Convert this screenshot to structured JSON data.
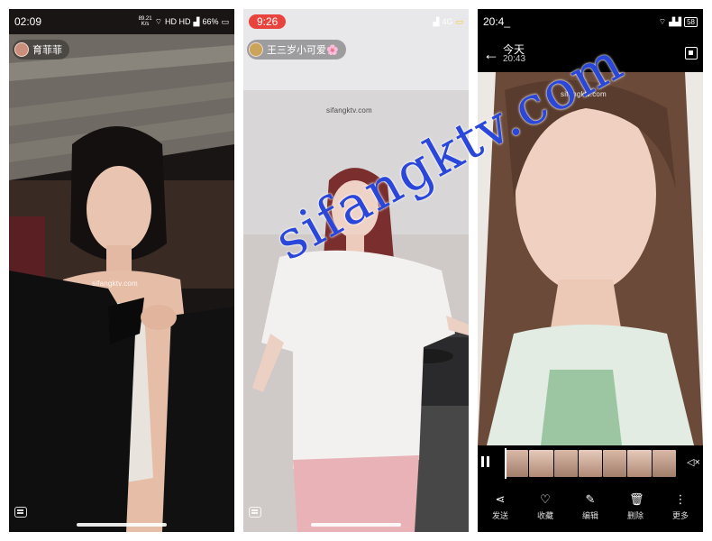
{
  "watermark": "sifangktv.com",
  "small_watermark": "sifangktv.com",
  "panel1": {
    "time": "02:09",
    "net_speed_top": "89.21",
    "net_speed_unit": "K/s",
    "signal_text": "HD HD",
    "battery": "66%",
    "streamer_name": "育菲菲"
  },
  "panel2": {
    "time": "9:26",
    "network": "4G",
    "streamer_name": "王三岁小可爱🌸"
  },
  "panel3": {
    "status_time": "20:4_",
    "viewer_title": "今天",
    "viewer_subtitle": "20:43",
    "battery": "58",
    "toolbar": [
      {
        "label": "发送",
        "icon": "share-icon",
        "glyph": "⋖"
      },
      {
        "label": "收藏",
        "icon": "heart-icon",
        "glyph": "♡"
      },
      {
        "label": "编辑",
        "icon": "edit-icon",
        "glyph": "✎"
      },
      {
        "label": "删除",
        "icon": "trash-icon",
        "glyph": "🗑"
      },
      {
        "label": "更多",
        "icon": "more-icon",
        "glyph": "⋮"
      }
    ]
  },
  "colors": {
    "watermark_blue": "#2a47d9",
    "time_badge": "#e8433c"
  }
}
